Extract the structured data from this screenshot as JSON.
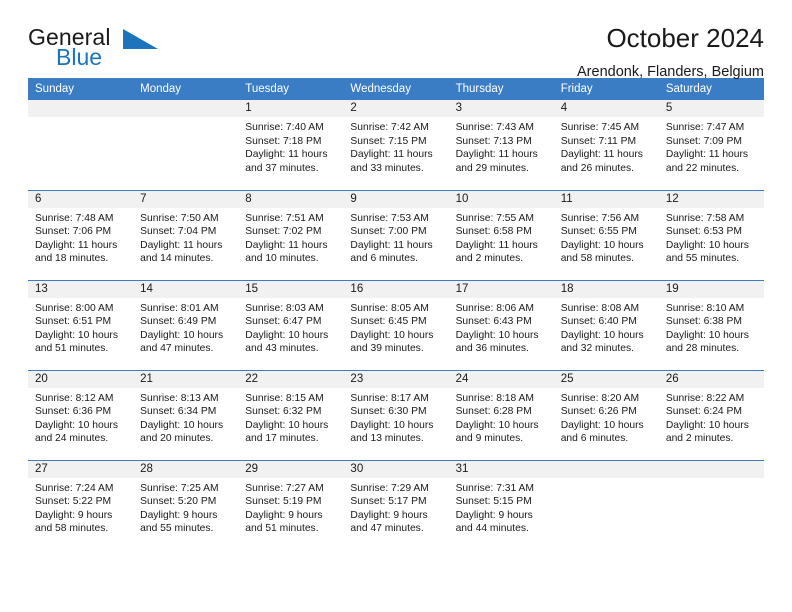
{
  "brand": {
    "word_one": "General",
    "word_two": "Blue",
    "accent_color": "#1c74bd"
  },
  "header": {
    "title": "October 2024",
    "location": "Arendonk, Flanders, Belgium"
  },
  "theme": {
    "header_bar_color": "#3b7dc4",
    "daynum_band_color": "#f1f1f1",
    "grid_line_color": "#3b7dc4"
  },
  "weekday_headers": [
    "Sunday",
    "Monday",
    "Tuesday",
    "Wednesday",
    "Thursday",
    "Friday",
    "Saturday"
  ],
  "weeks": [
    [
      {
        "empty": true
      },
      {
        "empty": true
      },
      {
        "day": "1",
        "sunrise": "Sunrise: 7:40 AM",
        "sunset": "Sunset: 7:18 PM",
        "daylight_1": "Daylight: 11 hours",
        "daylight_2": "and 37 minutes."
      },
      {
        "day": "2",
        "sunrise": "Sunrise: 7:42 AM",
        "sunset": "Sunset: 7:15 PM",
        "daylight_1": "Daylight: 11 hours",
        "daylight_2": "and 33 minutes."
      },
      {
        "day": "3",
        "sunrise": "Sunrise: 7:43 AM",
        "sunset": "Sunset: 7:13 PM",
        "daylight_1": "Daylight: 11 hours",
        "daylight_2": "and 29 minutes."
      },
      {
        "day": "4",
        "sunrise": "Sunrise: 7:45 AM",
        "sunset": "Sunset: 7:11 PM",
        "daylight_1": "Daylight: 11 hours",
        "daylight_2": "and 26 minutes."
      },
      {
        "day": "5",
        "sunrise": "Sunrise: 7:47 AM",
        "sunset": "Sunset: 7:09 PM",
        "daylight_1": "Daylight: 11 hours",
        "daylight_2": "and 22 minutes."
      }
    ],
    [
      {
        "day": "6",
        "sunrise": "Sunrise: 7:48 AM",
        "sunset": "Sunset: 7:06 PM",
        "daylight_1": "Daylight: 11 hours",
        "daylight_2": "and 18 minutes."
      },
      {
        "day": "7",
        "sunrise": "Sunrise: 7:50 AM",
        "sunset": "Sunset: 7:04 PM",
        "daylight_1": "Daylight: 11 hours",
        "daylight_2": "and 14 minutes."
      },
      {
        "day": "8",
        "sunrise": "Sunrise: 7:51 AM",
        "sunset": "Sunset: 7:02 PM",
        "daylight_1": "Daylight: 11 hours",
        "daylight_2": "and 10 minutes."
      },
      {
        "day": "9",
        "sunrise": "Sunrise: 7:53 AM",
        "sunset": "Sunset: 7:00 PM",
        "daylight_1": "Daylight: 11 hours",
        "daylight_2": "and 6 minutes."
      },
      {
        "day": "10",
        "sunrise": "Sunrise: 7:55 AM",
        "sunset": "Sunset: 6:58 PM",
        "daylight_1": "Daylight: 11 hours",
        "daylight_2": "and 2 minutes."
      },
      {
        "day": "11",
        "sunrise": "Sunrise: 7:56 AM",
        "sunset": "Sunset: 6:55 PM",
        "daylight_1": "Daylight: 10 hours",
        "daylight_2": "and 58 minutes."
      },
      {
        "day": "12",
        "sunrise": "Sunrise: 7:58 AM",
        "sunset": "Sunset: 6:53 PM",
        "daylight_1": "Daylight: 10 hours",
        "daylight_2": "and 55 minutes."
      }
    ],
    [
      {
        "day": "13",
        "sunrise": "Sunrise: 8:00 AM",
        "sunset": "Sunset: 6:51 PM",
        "daylight_1": "Daylight: 10 hours",
        "daylight_2": "and 51 minutes."
      },
      {
        "day": "14",
        "sunrise": "Sunrise: 8:01 AM",
        "sunset": "Sunset: 6:49 PM",
        "daylight_1": "Daylight: 10 hours",
        "daylight_2": "and 47 minutes."
      },
      {
        "day": "15",
        "sunrise": "Sunrise: 8:03 AM",
        "sunset": "Sunset: 6:47 PM",
        "daylight_1": "Daylight: 10 hours",
        "daylight_2": "and 43 minutes."
      },
      {
        "day": "16",
        "sunrise": "Sunrise: 8:05 AM",
        "sunset": "Sunset: 6:45 PM",
        "daylight_1": "Daylight: 10 hours",
        "daylight_2": "and 39 minutes."
      },
      {
        "day": "17",
        "sunrise": "Sunrise: 8:06 AM",
        "sunset": "Sunset: 6:43 PM",
        "daylight_1": "Daylight: 10 hours",
        "daylight_2": "and 36 minutes."
      },
      {
        "day": "18",
        "sunrise": "Sunrise: 8:08 AM",
        "sunset": "Sunset: 6:40 PM",
        "daylight_1": "Daylight: 10 hours",
        "daylight_2": "and 32 minutes."
      },
      {
        "day": "19",
        "sunrise": "Sunrise: 8:10 AM",
        "sunset": "Sunset: 6:38 PM",
        "daylight_1": "Daylight: 10 hours",
        "daylight_2": "and 28 minutes."
      }
    ],
    [
      {
        "day": "20",
        "sunrise": "Sunrise: 8:12 AM",
        "sunset": "Sunset: 6:36 PM",
        "daylight_1": "Daylight: 10 hours",
        "daylight_2": "and 24 minutes."
      },
      {
        "day": "21",
        "sunrise": "Sunrise: 8:13 AM",
        "sunset": "Sunset: 6:34 PM",
        "daylight_1": "Daylight: 10 hours",
        "daylight_2": "and 20 minutes."
      },
      {
        "day": "22",
        "sunrise": "Sunrise: 8:15 AM",
        "sunset": "Sunset: 6:32 PM",
        "daylight_1": "Daylight: 10 hours",
        "daylight_2": "and 17 minutes."
      },
      {
        "day": "23",
        "sunrise": "Sunrise: 8:17 AM",
        "sunset": "Sunset: 6:30 PM",
        "daylight_1": "Daylight: 10 hours",
        "daylight_2": "and 13 minutes."
      },
      {
        "day": "24",
        "sunrise": "Sunrise: 8:18 AM",
        "sunset": "Sunset: 6:28 PM",
        "daylight_1": "Daylight: 10 hours",
        "daylight_2": "and 9 minutes."
      },
      {
        "day": "25",
        "sunrise": "Sunrise: 8:20 AM",
        "sunset": "Sunset: 6:26 PM",
        "daylight_1": "Daylight: 10 hours",
        "daylight_2": "and 6 minutes."
      },
      {
        "day": "26",
        "sunrise": "Sunrise: 8:22 AM",
        "sunset": "Sunset: 6:24 PM",
        "daylight_1": "Daylight: 10 hours",
        "daylight_2": "and 2 minutes."
      }
    ],
    [
      {
        "day": "27",
        "sunrise": "Sunrise: 7:24 AM",
        "sunset": "Sunset: 5:22 PM",
        "daylight_1": "Daylight: 9 hours",
        "daylight_2": "and 58 minutes."
      },
      {
        "day": "28",
        "sunrise": "Sunrise: 7:25 AM",
        "sunset": "Sunset: 5:20 PM",
        "daylight_1": "Daylight: 9 hours",
        "daylight_2": "and 55 minutes."
      },
      {
        "day": "29",
        "sunrise": "Sunrise: 7:27 AM",
        "sunset": "Sunset: 5:19 PM",
        "daylight_1": "Daylight: 9 hours",
        "daylight_2": "and 51 minutes."
      },
      {
        "day": "30",
        "sunrise": "Sunrise: 7:29 AM",
        "sunset": "Sunset: 5:17 PM",
        "daylight_1": "Daylight: 9 hours",
        "daylight_2": "and 47 minutes."
      },
      {
        "day": "31",
        "sunrise": "Sunrise: 7:31 AM",
        "sunset": "Sunset: 5:15 PM",
        "daylight_1": "Daylight: 9 hours",
        "daylight_2": "and 44 minutes."
      },
      {
        "empty": true
      },
      {
        "empty": true
      }
    ]
  ]
}
